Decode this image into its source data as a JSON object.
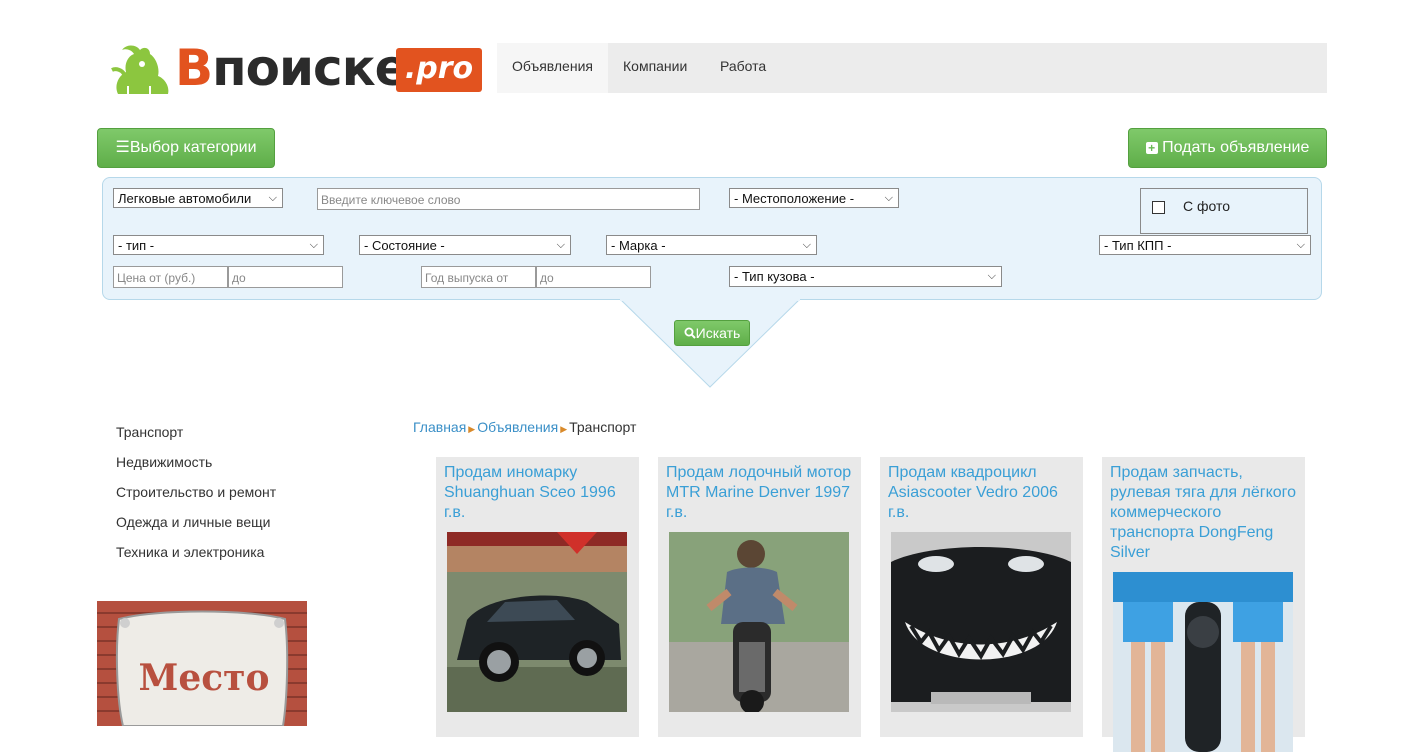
{
  "logo": {
    "part1": "В",
    "part2": "поиске",
    "badge": ".pro"
  },
  "nav": {
    "tabs": [
      "Объявления",
      "Компании",
      "Работа"
    ]
  },
  "buttons": {
    "category": "Выбор категории",
    "post_ad": "Подать объявление",
    "search": "Искать"
  },
  "filters": {
    "category": "Легковые автомобили",
    "keyword_placeholder": "Введите ключевое слово",
    "location": "- Местоположение -",
    "with_photo": "С фото",
    "type": "- тип -",
    "condition": "- Состояние -",
    "brand": "- Марка -",
    "gearbox": "- Тип КПП -",
    "price_from_placeholder": "Цена от (руб.)",
    "price_to_placeholder": "до",
    "year_from_placeholder": "Год выпуска от",
    "year_to_placeholder": "до",
    "body_type": "- Тип кузова -"
  },
  "sidebar": {
    "categories": [
      "Транспорт",
      "Недвижимость",
      "Строительство и ремонт",
      "Одежда и личные вещи",
      "Техника и электроника"
    ]
  },
  "ad_banner": {
    "text": "Место"
  },
  "breadcrumb": {
    "home": "Главная",
    "section": "Объявления",
    "current": "Транспорт"
  },
  "listings": [
    {
      "title": "Продам иномарку Shuanghuan Sceo 1996 г.в."
    },
    {
      "title": "Продам лодочный мотор MTR Marine Denver 1997 г.в."
    },
    {
      "title": "Продам квадроцикл Asiascooter Vedro 2006 г.в."
    },
    {
      "title": "Продам запчасть, рулевая тяга для лёгкого коммерческого транспорта DongFeng Silver"
    }
  ],
  "colors": {
    "accent_green": "#6ab955",
    "logo_orange": "#e2531f",
    "link_blue": "#3a9fd6",
    "panel_blue": "#e8f3fb"
  }
}
